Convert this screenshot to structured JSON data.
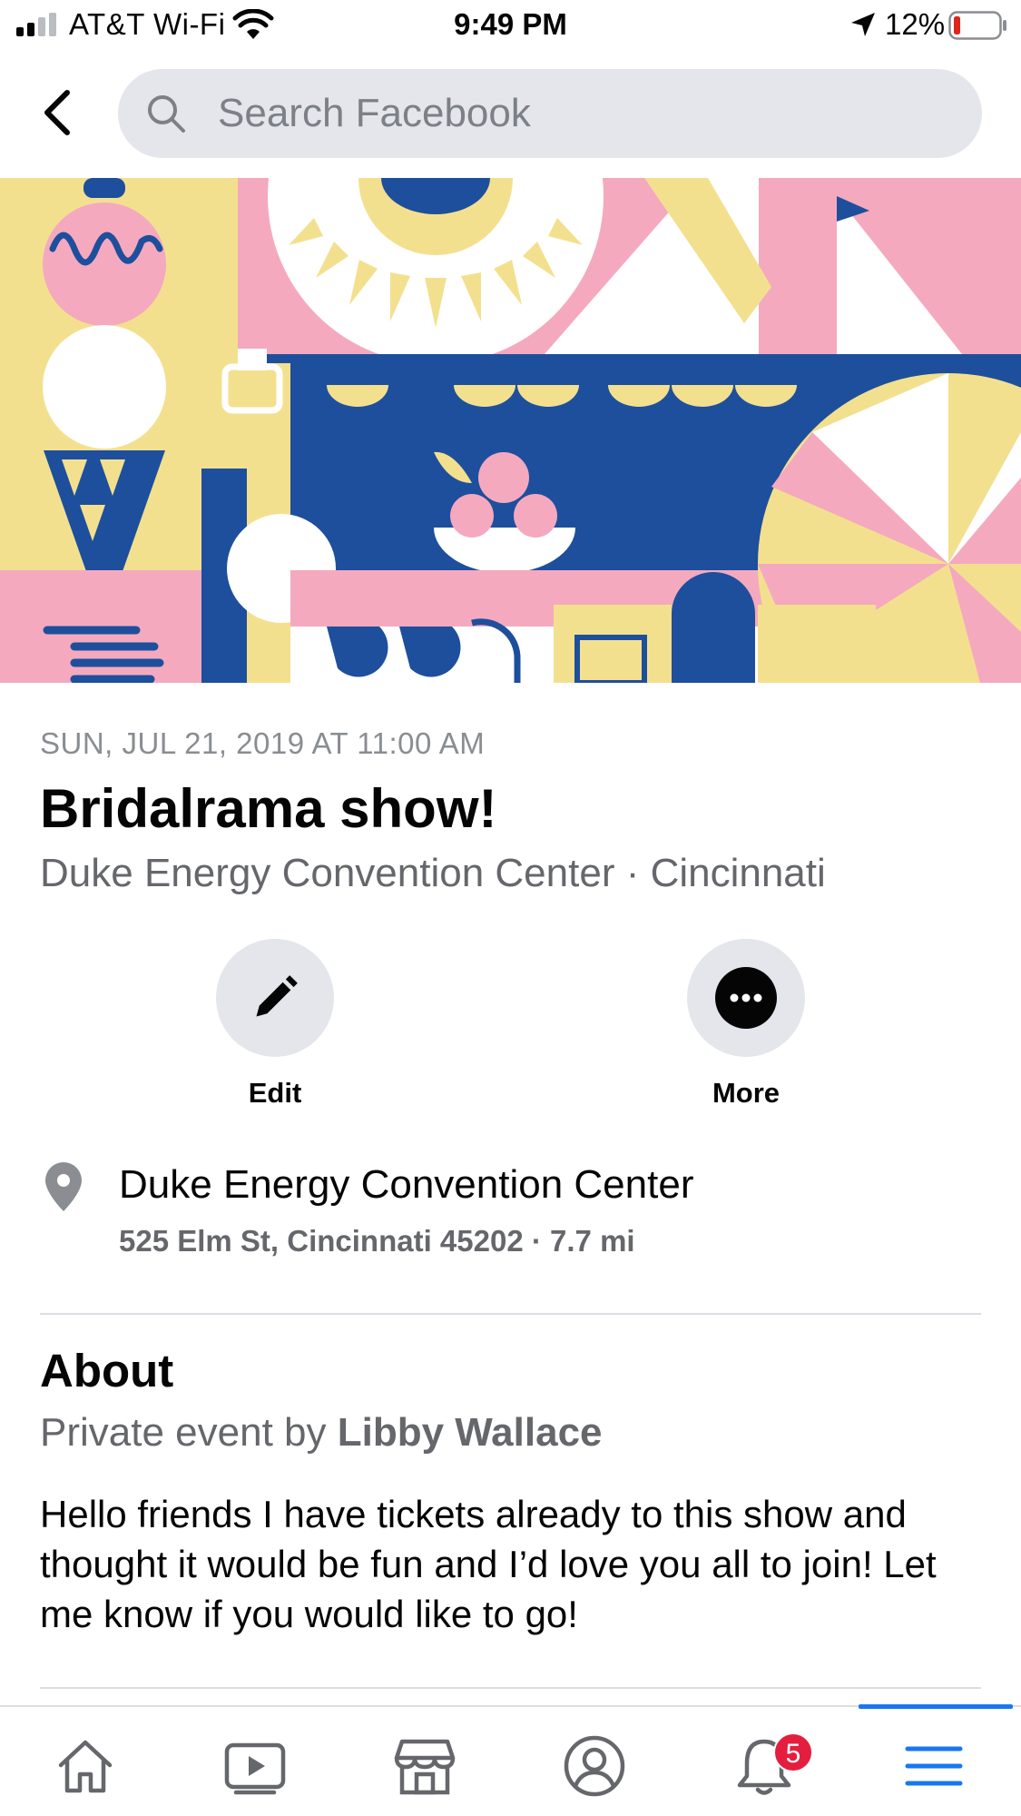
{
  "status_bar": {
    "carrier": "AT&T Wi-Fi",
    "time": "9:49 PM",
    "battery_percent": "12%",
    "battery_level": 0.12,
    "icons": [
      "cellular-signal-icon",
      "wifi-icon",
      "location-arrow-icon",
      "battery-icon"
    ]
  },
  "header": {
    "search_placeholder": "Search Facebook",
    "icons": [
      "back-icon",
      "search-icon"
    ]
  },
  "event": {
    "date": "SUN, JUL 21, 2019 AT 11:00 AM",
    "title": "Bridalrama show!",
    "subtitle": "Duke Energy Convention Center · Cincinnati"
  },
  "actions": [
    {
      "label": "Edit",
      "icon": "pencil-icon"
    },
    {
      "label": "More",
      "icon": "more-dots-icon"
    }
  ],
  "location": {
    "name": "Duke Energy Convention Center",
    "address": "525 Elm St, Cincinnati 45202 · 7.7 mi",
    "icon": "map-pin-icon"
  },
  "about": {
    "heading": "About",
    "privacy_prefix": "Private event by ",
    "host": "Libby Wallace",
    "description": "Hello friends I have tickets already to this show and thought it would be fun and I’d love you all to join! Let me know if you would like to go!"
  },
  "tab_bar": {
    "tabs": [
      {
        "name": "home",
        "icon": "home-icon"
      },
      {
        "name": "watch",
        "icon": "video-play-icon"
      },
      {
        "name": "marketplace",
        "icon": "marketplace-store-icon"
      },
      {
        "name": "profile",
        "icon": "profile-icon"
      },
      {
        "name": "notifications",
        "icon": "bell-icon"
      },
      {
        "name": "menu",
        "icon": "hamburger-menu-icon",
        "active": true
      }
    ],
    "notification_badge": "5"
  },
  "colors": {
    "accent_blue": "#1877f2",
    "badge_red": "#e41e3f",
    "cover_blue": "#1d4f9c",
    "cover_pink": "#f5a9bf",
    "cover_yellow": "#f3e08f"
  }
}
